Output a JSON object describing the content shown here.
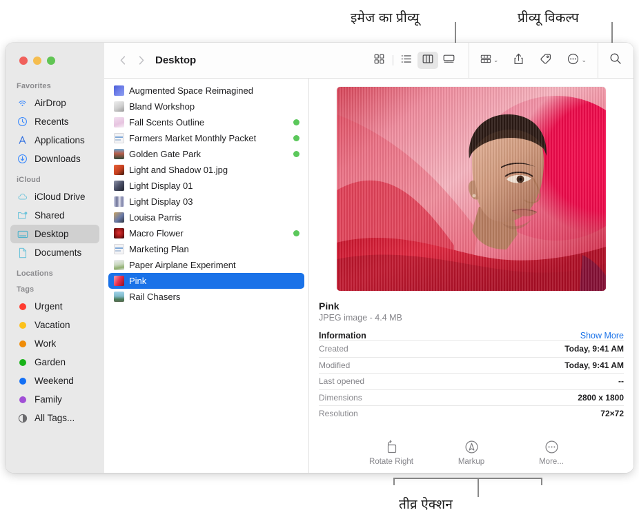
{
  "annotations": {
    "image_preview": "इमेज का प्रीव्यू",
    "preview_options": "प्रीव्यू विकल्प",
    "quick_actions": "तीव्र ऐक्शन"
  },
  "window": {
    "title": "Desktop",
    "traffic_lights": [
      "close-button",
      "minimize-button",
      "zoom-button"
    ]
  },
  "toolbar": {
    "back_icon": "chevron-left-icon",
    "forward_icon": "chevron-right-icon",
    "view_modes": [
      {
        "name": "icon-view",
        "icon": "grid-icon",
        "active": false
      },
      {
        "name": "list-view",
        "icon": "list-icon",
        "active": false
      },
      {
        "name": "column-view",
        "icon": "columns-icon",
        "active": true
      },
      {
        "name": "gallery-view",
        "icon": "gallery-icon",
        "active": false
      }
    ],
    "group_button": {
      "name": "group-by-button",
      "icon": "group-icon",
      "chevron": "⌄"
    },
    "share_button": {
      "name": "share-button",
      "icon": "share-icon"
    },
    "tag_button": {
      "name": "tag-button",
      "icon": "tag-icon"
    },
    "action_button": {
      "name": "action-menu-button",
      "icon": "ellipsis-circle-icon",
      "chevron": "⌄"
    },
    "search_button": {
      "name": "search-button",
      "icon": "search-icon"
    }
  },
  "sidebar": {
    "sections": [
      {
        "header": "Favorites",
        "items": [
          {
            "label": "AirDrop",
            "icon": "airdrop-icon",
            "selected": false
          },
          {
            "label": "Recents",
            "icon": "clock-icon",
            "selected": false
          },
          {
            "label": "Applications",
            "icon": "applications-icon",
            "selected": false
          },
          {
            "label": "Downloads",
            "icon": "download-icon",
            "selected": false
          }
        ]
      },
      {
        "header": "iCloud",
        "items": [
          {
            "label": "iCloud Drive",
            "icon": "cloud-icon",
            "selected": false
          },
          {
            "label": "Shared",
            "icon": "shared-folder-icon",
            "selected": false
          },
          {
            "label": "Desktop",
            "icon": "desktop-icon",
            "selected": true
          },
          {
            "label": "Documents",
            "icon": "document-icon",
            "selected": false
          }
        ]
      },
      {
        "header": "Locations",
        "items": []
      },
      {
        "header": "Tags",
        "items": [
          {
            "label": "Urgent",
            "icon": "tag-dot-icon",
            "color": "#ff3b30",
            "selected": false
          },
          {
            "label": "Vacation",
            "icon": "tag-dot-icon",
            "color": "#fcc11b",
            "selected": false
          },
          {
            "label": "Work",
            "icon": "tag-dot-icon",
            "color": "#ef8c08",
            "selected": false
          },
          {
            "label": "Garden",
            "icon": "tag-dot-icon",
            "color": "#19b319",
            "selected": false
          },
          {
            "label": "Weekend",
            "icon": "tag-dot-icon",
            "color": "#1470f5",
            "selected": false
          },
          {
            "label": "Family",
            "icon": "tag-dot-icon",
            "color": "#a14fd6",
            "selected": false
          },
          {
            "label": "All Tags...",
            "icon": "all-tags-icon",
            "color": "",
            "selected": false
          }
        ]
      }
    ]
  },
  "filelist": {
    "files": [
      {
        "name": "Augmented Space Reimagined",
        "thumb": "c1",
        "tag": false,
        "selected": false
      },
      {
        "name": "Bland Workshop",
        "thumb": "c2",
        "tag": false,
        "selected": false
      },
      {
        "name": "Fall Scents Outline",
        "thumb": "c3",
        "tag": true,
        "selected": false
      },
      {
        "name": "Farmers Market Monthly Packet",
        "thumb": "doc",
        "tag": true,
        "selected": false
      },
      {
        "name": "Golden Gate Park",
        "thumb": "c4",
        "tag": true,
        "selected": false
      },
      {
        "name": "Light and Shadow 01.jpg",
        "thumb": "c5",
        "tag": false,
        "selected": false
      },
      {
        "name": "Light Display 01",
        "thumb": "c6",
        "tag": false,
        "selected": false
      },
      {
        "name": "Light Display 03",
        "thumb": "c7",
        "tag": false,
        "selected": false
      },
      {
        "name": "Louisa Parris",
        "thumb": "c8",
        "tag": false,
        "selected": false
      },
      {
        "name": "Macro Flower",
        "thumb": "c9",
        "tag": true,
        "selected": false
      },
      {
        "name": "Marketing Plan",
        "thumb": "doc",
        "tag": false,
        "selected": false
      },
      {
        "name": "Paper Airplane Experiment",
        "thumb": "c10",
        "tag": false,
        "selected": false
      },
      {
        "name": "Pink",
        "thumb": "c11",
        "tag": false,
        "selected": true
      },
      {
        "name": "Rail Chasers",
        "thumb": "c12",
        "tag": false,
        "selected": false
      }
    ]
  },
  "preview": {
    "file_name": "Pink",
    "file_kind": "JPEG image - 4.4 MB",
    "information_header": "Information",
    "show_more": "Show More",
    "rows": [
      {
        "key": "Created",
        "value": "Today, 9:41 AM"
      },
      {
        "key": "Modified",
        "value": "Today, 9:41 AM"
      },
      {
        "key": "Last opened",
        "value": "--"
      },
      {
        "key": "Dimensions",
        "value": "2800 x 1800"
      },
      {
        "key": "Resolution",
        "value": "72×72"
      }
    ],
    "quick_actions": [
      {
        "label": "Rotate Right",
        "icon": "rotate-right-icon"
      },
      {
        "label": "Markup",
        "icon": "markup-icon"
      },
      {
        "label": "More...",
        "icon": "ellipsis-circle-icon"
      }
    ]
  },
  "colors": {
    "selection_blue": "#1a72e8",
    "link_blue": "#1a72e8",
    "green_tag": "#5bc85b",
    "sidebar_bg": "#e9e9e9"
  }
}
